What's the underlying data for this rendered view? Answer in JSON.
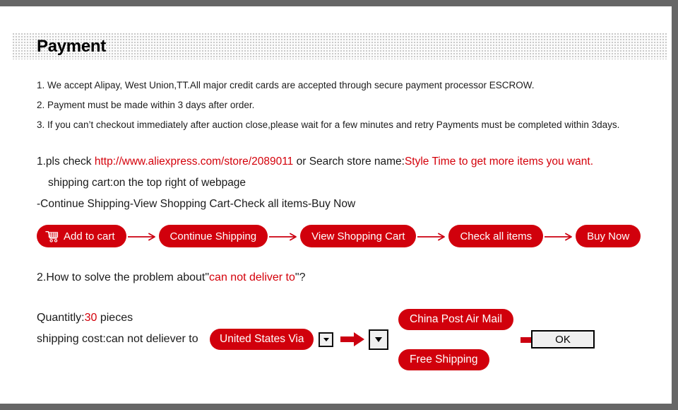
{
  "frame": {
    "bar_color": "#666666"
  },
  "header": {
    "title": "Payment",
    "pattern": "dotted-grid"
  },
  "terms": {
    "items": [
      "1. We accept Alipay, West Union,TT.All major credit cards are accepted through secure payment processor ESCROW.",
      "2. Payment must be made within 3 days after order.",
      "3. If you can’t checkout immediately after auction close,please wait for a few minutes and retry Payments must be completed within 3days."
    ]
  },
  "store_info": {
    "line1_prefix": "1.pls check ",
    "line1_url": "http://www.aliexpress.com/store/2089011",
    "line1_middle": " or Search store name:",
    "line1_store": "Style Time to get more items you want.",
    "line2": "shipping cart:on the top right of webpage",
    "line3": "-Continue Shipping-View Shopping Cart-Check all items-Buy Now"
  },
  "flow": {
    "steps": [
      {
        "label": "Add to cart",
        "icon": "shopping-cart-icon"
      },
      {
        "label": "Continue Shipping",
        "icon": null
      },
      {
        "label": "View Shopping Cart",
        "icon": null
      },
      {
        "label": "Check all items",
        "icon": null
      },
      {
        "label": "Buy Now",
        "icon": null
      }
    ],
    "connector": "arrow-right-icon"
  },
  "question": {
    "prefix": "2.How to solve the problem about\"",
    "highlight": "can not deliver to",
    "suffix": "\"?"
  },
  "calculator": {
    "qty_label": "Quantitly:",
    "qty_value": "30",
    "qty_unit": " pieces",
    "cost_label": "shipping cost:can not deliever to",
    "country": "United States Via",
    "dropdown_small": "chevron-down-icon",
    "dropdown_large": "chevron-down-icon",
    "arrow_1": "block-arrow-right-icon",
    "arrow_2": "block-arrow-right-icon",
    "options": [
      "China Post Air Mail",
      "Free Shipping"
    ],
    "ok_label": "OK"
  },
  "colors": {
    "brand_red": "#d1000c",
    "text_red": "#d4000a",
    "bar_gray": "#666666",
    "button_face": "#f0f0f0"
  }
}
